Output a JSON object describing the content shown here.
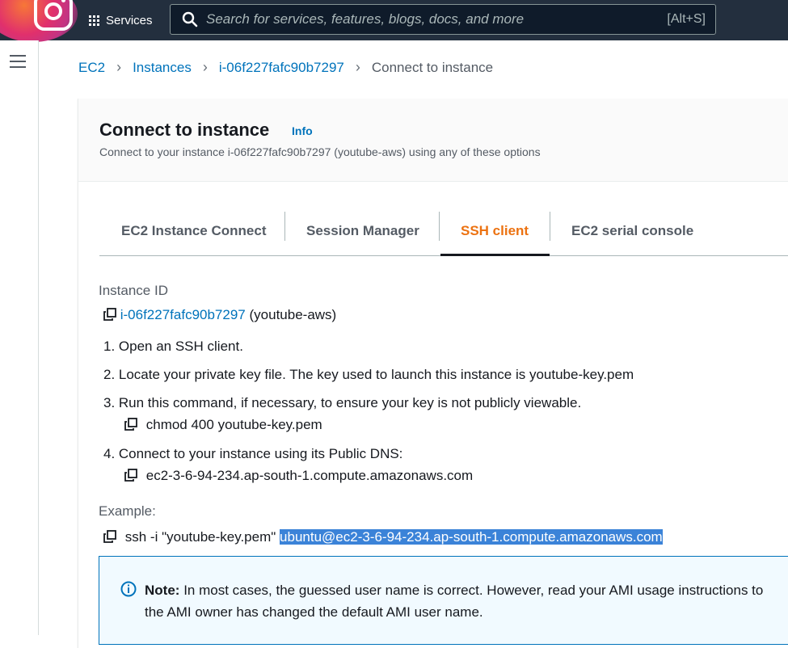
{
  "topbar": {
    "services_label": "Services",
    "search_placeholder": "Search for services, features, blogs, docs, and more",
    "search_shortcut": "[Alt+S]"
  },
  "breadcrumb": {
    "items": [
      "EC2",
      "Instances",
      "i-06f227fafc90b7297"
    ],
    "current": "Connect to instance"
  },
  "header": {
    "title": "Connect to instance",
    "info": "Info",
    "description": "Connect to your instance i-06f227fafc90b7297 (youtube-aws) using any of these options"
  },
  "tabs": [
    {
      "label": "EC2 Instance Connect"
    },
    {
      "label": "Session Manager"
    },
    {
      "label": "SSH client",
      "active": true
    },
    {
      "label": "EC2 serial console"
    }
  ],
  "ssh": {
    "instance_id_label": "Instance ID",
    "instance_id": "i-06f227fafc90b7297",
    "instance_name": "(youtube-aws)",
    "step1": "1. Open an SSH client.",
    "step2": "2. Locate your private key file. The key used to launch this instance is youtube-key.pem",
    "step3": "3. Run this command, if necessary, to ensure your key is not publicly viewable.",
    "step3_cmd": "chmod 400 youtube-key.pem",
    "step4": "4. Connect to your instance using its Public DNS:",
    "step4_dns": "ec2-3-6-94-234.ap-south-1.compute.amazonaws.com",
    "example_label": "Example:",
    "example_prefix": "ssh -i \"youtube-key.pem\"",
    "example_selected": "ubuntu@ec2-3-6-94-234.ap-south-1.compute.amazonaws.com"
  },
  "note": {
    "bold": "Note:",
    "text": "In most cases, the guessed user name is correct. However, read your AMI usage instructions to",
    "text2": "the AMI owner has changed the default AMI user name."
  },
  "colors": {
    "topbar": "#232f3e",
    "link": "#0073bb",
    "active_tab": "#ec7211",
    "selection": "#3b83d8"
  }
}
